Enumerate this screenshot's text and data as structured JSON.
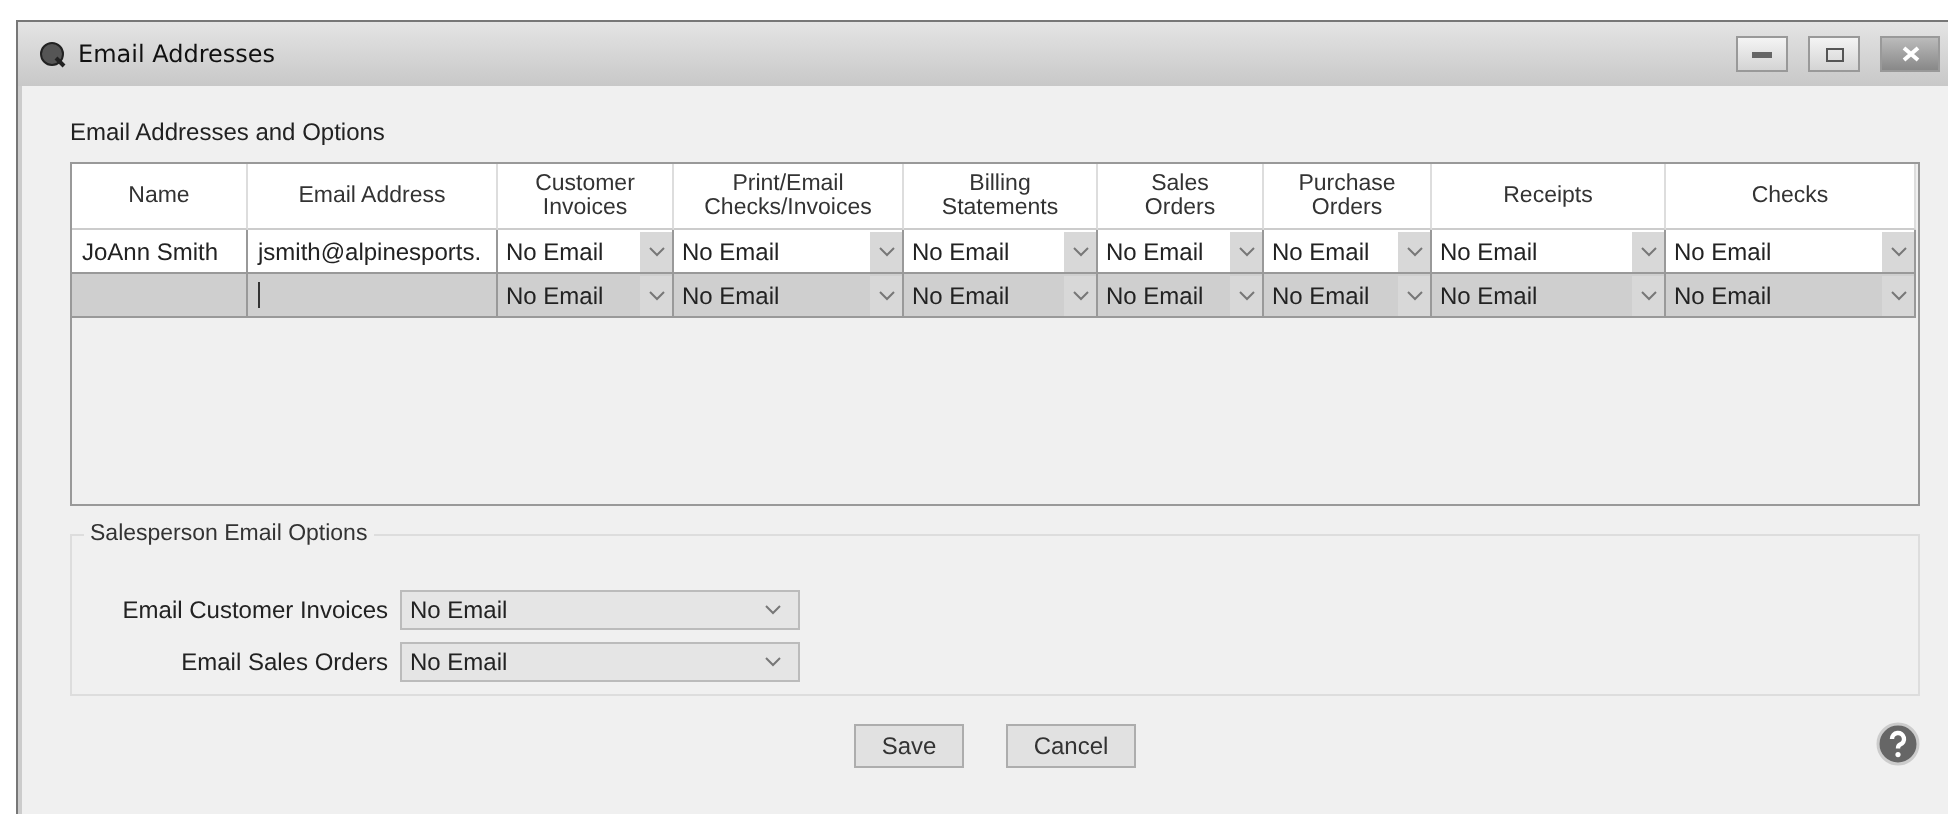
{
  "window": {
    "title": "Email Addresses"
  },
  "grid": {
    "title": "Email Addresses and Options",
    "columns": [
      "Name",
      "Email Address",
      "Customer Invoices",
      "Print/Email Checks/Invoices",
      "Billing Statements",
      "Sales Orders",
      "Purchase Orders",
      "Receipts",
      "Checks"
    ],
    "rows": [
      {
        "selected": false,
        "name": "JoAnn Smith",
        "email": "jsmith@alpinesports.",
        "options": [
          "No Email",
          "No Email",
          "No Email",
          "No Email",
          "No Email",
          "No Email",
          "No Email"
        ]
      },
      {
        "selected": true,
        "editing": true,
        "options": [
          "No Email",
          "No Email",
          "No Email",
          "No Email",
          "No Email",
          "No Email",
          "No Email"
        ]
      }
    ]
  },
  "salesperson": {
    "title": "Salesperson Email Options",
    "fields": [
      {
        "label": "Email Customer Invoices",
        "value": "No Email"
      },
      {
        "label": "Email Sales Orders",
        "value": "No Email"
      }
    ]
  },
  "buttons": [
    "Save",
    "Cancel"
  ]
}
